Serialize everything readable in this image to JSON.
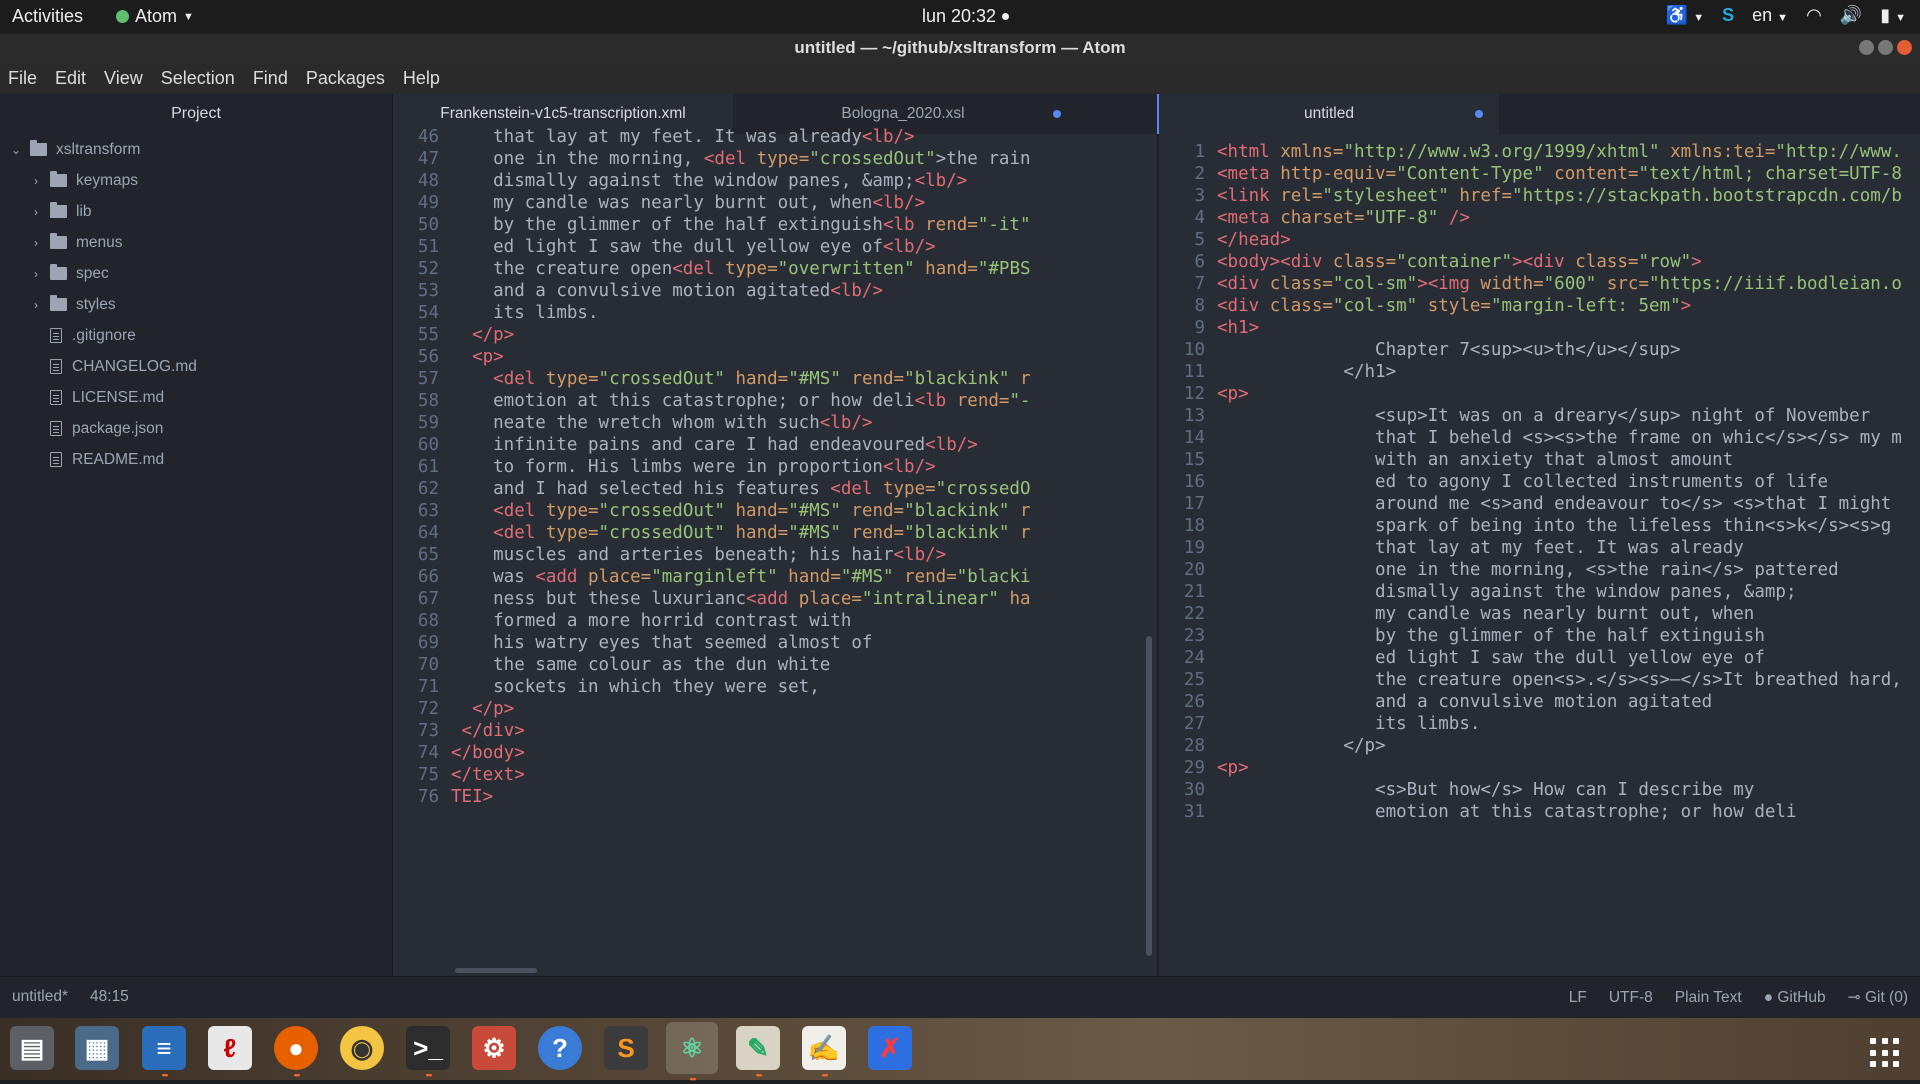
{
  "topbar": {
    "activities": "Activities",
    "app_name": "Atom",
    "clock": "lun 20:32",
    "lang": "en"
  },
  "window": {
    "title": "untitled — ~/github/xsltransform — Atom"
  },
  "menu": [
    "File",
    "Edit",
    "View",
    "Selection",
    "Find",
    "Packages",
    "Help"
  ],
  "tree": {
    "header": "Project",
    "root": "xsltransform",
    "folders": [
      "keymaps",
      "lib",
      "menus",
      "spec",
      "styles"
    ],
    "files": [
      ".gitignore",
      "CHANGELOG.md",
      "LICENSE.md",
      "package.json",
      "README.md"
    ]
  },
  "left_tabs": [
    {
      "label": "Frankenstein-v1c5-transcription.xml",
      "modified": false,
      "active": true
    },
    {
      "label": "Bologna_2020.xsl",
      "modified": true,
      "active": false
    }
  ],
  "right_tabs": [
    {
      "label": "untitled",
      "modified": true,
      "active": true
    }
  ],
  "left_lines": [
    {
      "n": "46",
      "t": [
        [
          "    that lay at my feet. It was already",
          ""
        ],
        [
          "<lb/>",
          "tg"
        ]
      ]
    },
    {
      "n": "47",
      "t": [
        [
          "    one in the morning, ",
          ""
        ],
        [
          "<del ",
          "tg"
        ],
        [
          "type=",
          "at"
        ],
        [
          "\"crossedOut\"",
          "st"
        ],
        [
          ">the rain",
          ""
        ]
      ]
    },
    {
      "n": "48",
      "t": [
        [
          "    dismally against the window panes, &amp;",
          ""
        ],
        [
          "<lb/>",
          "tg"
        ]
      ]
    },
    {
      "n": "49",
      "t": [
        [
          "    my candle was nearly burnt out, when",
          ""
        ],
        [
          "<lb/>",
          "tg"
        ]
      ]
    },
    {
      "n": "50",
      "t": [
        [
          "    by the glimmer of the half extinguish",
          ""
        ],
        [
          "<lb ",
          "tg"
        ],
        [
          "rend=",
          "at"
        ],
        [
          "\"-it\"",
          "st"
        ]
      ]
    },
    {
      "n": "51",
      "t": [
        [
          "    ed light I saw the dull yellow eye of",
          ""
        ],
        [
          "<lb/>",
          "tg"
        ]
      ]
    },
    {
      "n": "52",
      "t": [
        [
          "    the creature open",
          ""
        ],
        [
          "<del ",
          "tg"
        ],
        [
          "type=",
          "at"
        ],
        [
          "\"overwritten\" ",
          "st"
        ],
        [
          "hand=",
          "at"
        ],
        [
          "\"#PBS",
          "st"
        ]
      ]
    },
    {
      "n": "53",
      "t": [
        [
          "    and a convulsive motion agitated",
          ""
        ],
        [
          "<lb/>",
          "tg"
        ]
      ]
    },
    {
      "n": "54",
      "t": [
        [
          "    its limbs.",
          ""
        ]
      ]
    },
    {
      "n": "55",
      "t": [
        [
          "  ",
          ""
        ],
        [
          "</p>",
          "tg"
        ]
      ]
    },
    {
      "n": "56",
      "t": [
        [
          "  ",
          ""
        ],
        [
          "<p>",
          "tg"
        ]
      ]
    },
    {
      "n": "57",
      "t": [
        [
          "    ",
          ""
        ],
        [
          "<del ",
          "tg"
        ],
        [
          "type=",
          "at"
        ],
        [
          "\"crossedOut\" ",
          "st"
        ],
        [
          "hand=",
          "at"
        ],
        [
          "\"#MS\" ",
          "st"
        ],
        [
          "rend=",
          "at"
        ],
        [
          "\"blackink\" ",
          "st"
        ],
        [
          "r",
          "at"
        ]
      ]
    },
    {
      "n": "58",
      "t": [
        [
          "    emotion at this catastrophe; or how deli",
          ""
        ],
        [
          "<lb ",
          "tg"
        ],
        [
          "rend=",
          "at"
        ],
        [
          "\"-",
          "st"
        ]
      ]
    },
    {
      "n": "59",
      "t": [
        [
          "    neate the wretch whom with such",
          ""
        ],
        [
          "<lb/>",
          "tg"
        ]
      ]
    },
    {
      "n": "60",
      "t": [
        [
          "    infinite pains and care I had endeavoured",
          ""
        ],
        [
          "<lb/>",
          "tg"
        ]
      ]
    },
    {
      "n": "61",
      "t": [
        [
          "    to form. His limbs were in proportion",
          ""
        ],
        [
          "<lb/>",
          "tg"
        ]
      ]
    },
    {
      "n": "62",
      "t": [
        [
          "    and I had selected his features ",
          ""
        ],
        [
          "<del ",
          "tg"
        ],
        [
          "type=",
          "at"
        ],
        [
          "\"crossedO",
          "st"
        ]
      ]
    },
    {
      "n": "63",
      "t": [
        [
          "    ",
          ""
        ],
        [
          "<del ",
          "tg"
        ],
        [
          "type=",
          "at"
        ],
        [
          "\"crossedOut\" ",
          "st"
        ],
        [
          "hand=",
          "at"
        ],
        [
          "\"#MS\" ",
          "st"
        ],
        [
          "rend=",
          "at"
        ],
        [
          "\"blackink\" ",
          "st"
        ],
        [
          "r",
          "at"
        ]
      ]
    },
    {
      "n": "64",
      "t": [
        [
          "    ",
          ""
        ],
        [
          "<del ",
          "tg"
        ],
        [
          "type=",
          "at"
        ],
        [
          "\"crossedOut\" ",
          "st"
        ],
        [
          "hand=",
          "at"
        ],
        [
          "\"#MS\" ",
          "st"
        ],
        [
          "rend=",
          "at"
        ],
        [
          "\"blackink\" ",
          "st"
        ],
        [
          "r",
          "at"
        ]
      ]
    },
    {
      "n": "65",
      "t": [
        [
          "    muscles and arteries beneath; his hair",
          ""
        ],
        [
          "<lb/>",
          "tg"
        ]
      ]
    },
    {
      "n": "66",
      "t": [
        [
          "    was ",
          ""
        ],
        [
          "<add ",
          "tg"
        ],
        [
          "place=",
          "at"
        ],
        [
          "\"marginleft\" ",
          "st"
        ],
        [
          "hand=",
          "at"
        ],
        [
          "\"#MS\" ",
          "st"
        ],
        [
          "rend=",
          "at"
        ],
        [
          "\"blacki",
          "st"
        ]
      ]
    },
    {
      "n": "67",
      "t": [
        [
          "    ness but these luxurianc",
          ""
        ],
        [
          "<add ",
          "tg"
        ],
        [
          "place=",
          "at"
        ],
        [
          "\"intralinear\" ",
          "st"
        ],
        [
          "ha",
          "at"
        ]
      ]
    },
    {
      "n": "68",
      "t": [
        [
          "    formed a more horrid contrast with",
          ""
        ]
      ]
    },
    {
      "n": "69",
      "t": [
        [
          "    his watry eyes that seemed almost of",
          ""
        ]
      ]
    },
    {
      "n": "70",
      "t": [
        [
          "    the same colour as the dun white",
          ""
        ]
      ]
    },
    {
      "n": "71",
      "t": [
        [
          "    sockets in which they were set,",
          ""
        ]
      ]
    },
    {
      "n": "72",
      "t": [
        [
          "  ",
          ""
        ],
        [
          "</p>",
          "tg"
        ]
      ]
    },
    {
      "n": "73",
      "t": [
        [
          " ",
          ""
        ],
        [
          "</div>",
          "tg"
        ]
      ]
    },
    {
      "n": "74",
      "t": [
        [
          "",
          ""
        ],
        [
          "</body>",
          "tg"
        ]
      ]
    },
    {
      "n": "75",
      "t": [
        [
          "",
          ""
        ],
        [
          "</text>",
          "tg"
        ]
      ]
    },
    {
      "n": "76",
      "t": [
        [
          "",
          ""
        ],
        [
          "TEI>",
          "tg"
        ]
      ]
    }
  ],
  "right_lines": [
    {
      "n": "1",
      "t": [
        [
          "<html ",
          "tg"
        ],
        [
          "xmlns=",
          "at"
        ],
        [
          "\"http://www.w3.org/1999/xhtml\" ",
          "st"
        ],
        [
          "xmlns:tei=",
          "at"
        ],
        [
          "\"http://www.",
          "st"
        ]
      ]
    },
    {
      "n": "2",
      "t": [
        [
          "<meta ",
          "tg"
        ],
        [
          "http-equiv=",
          "at"
        ],
        [
          "\"Content-Type\" ",
          "st"
        ],
        [
          "content=",
          "at"
        ],
        [
          "\"text/html; charset=UTF-8",
          "st"
        ]
      ]
    },
    {
      "n": "3",
      "t": [
        [
          "<link ",
          "tg"
        ],
        [
          "rel=",
          "at"
        ],
        [
          "\"stylesheet\" ",
          "st"
        ],
        [
          "href=",
          "at"
        ],
        [
          "\"https://stackpath.bootstrapcdn.com/b",
          "st"
        ]
      ]
    },
    {
      "n": "4",
      "t": [
        [
          "<meta ",
          "tg"
        ],
        [
          "charset=",
          "at"
        ],
        [
          "\"UTF-8\" ",
          "st"
        ],
        [
          "/>",
          "tg"
        ]
      ]
    },
    {
      "n": "5",
      "t": [
        [
          "</head>",
          "tg"
        ]
      ]
    },
    {
      "n": "6",
      "t": [
        [
          "<body><div ",
          "tg"
        ],
        [
          "class=",
          "at"
        ],
        [
          "\"container\"",
          "st"
        ],
        [
          "><div ",
          "tg"
        ],
        [
          "class=",
          "at"
        ],
        [
          "\"row\"",
          "st"
        ],
        [
          ">",
          "tg"
        ]
      ]
    },
    {
      "n": "7",
      "t": [
        [
          "<div ",
          "tg"
        ],
        [
          "class=",
          "at"
        ],
        [
          "\"col-sm\"",
          "st"
        ],
        [
          "><img ",
          "tg"
        ],
        [
          "width=",
          "at"
        ],
        [
          "\"600\" ",
          "st"
        ],
        [
          "src=",
          "at"
        ],
        [
          "\"https://iiif.bodleian.o",
          "st"
        ]
      ]
    },
    {
      "n": "8",
      "t": [
        [
          "<div ",
          "tg"
        ],
        [
          "class=",
          "at"
        ],
        [
          "\"col-sm\" ",
          "st"
        ],
        [
          "style=",
          "at"
        ],
        [
          "\"margin-left: 5em\"",
          "st"
        ],
        [
          ">",
          "tg"
        ]
      ]
    },
    {
      "n": "9",
      "t": [
        [
          "<h1>",
          "tg"
        ]
      ]
    },
    {
      "n": "10",
      "t": [
        [
          "               Chapter 7<sup><u>th</u></sup>",
          ""
        ]
      ]
    },
    {
      "n": "11",
      "t": [
        [
          "            </h1>",
          ""
        ]
      ]
    },
    {
      "n": "12",
      "t": [
        [
          "<p>",
          "tg"
        ]
      ]
    },
    {
      "n": "13",
      "t": [
        [
          "               <sup>It was on a dreary</sup> night of November",
          ""
        ]
      ]
    },
    {
      "n": "14",
      "t": [
        [
          "               that I beheld <s><s>the frame on whic</s></s> my m",
          ""
        ]
      ]
    },
    {
      "n": "15",
      "t": [
        [
          "               with an anxiety that almost amount",
          ""
        ]
      ]
    },
    {
      "n": "16",
      "t": [
        [
          "               ed to agony I collected instruments of life",
          ""
        ]
      ]
    },
    {
      "n": "17",
      "t": [
        [
          "               around me <s>and endeavour to</s> <s>that I might",
          ""
        ]
      ]
    },
    {
      "n": "18",
      "t": [
        [
          "               spark of being into the lifeless thin<s>k</s><s>g",
          ""
        ]
      ]
    },
    {
      "n": "19",
      "t": [
        [
          "               that lay at my feet. It was already",
          ""
        ]
      ]
    },
    {
      "n": "20",
      "t": [
        [
          "               one in the morning, <s>the rain</s> pattered",
          ""
        ]
      ]
    },
    {
      "n": "21",
      "t": [
        [
          "               dismally against the window panes, &amp;",
          ""
        ]
      ]
    },
    {
      "n": "22",
      "t": [
        [
          "               my candle was nearly burnt out, when",
          ""
        ]
      ]
    },
    {
      "n": "23",
      "t": [
        [
          "               by the glimmer of the half extinguish",
          ""
        ]
      ]
    },
    {
      "n": "24",
      "t": [
        [
          "               ed light I saw the dull yellow eye of",
          ""
        ]
      ]
    },
    {
      "n": "25",
      "t": [
        [
          "               the creature open<s>.</s><s>—</s>It breathed hard,",
          ""
        ]
      ]
    },
    {
      "n": "26",
      "t": [
        [
          "               and a convulsive motion agitated",
          ""
        ]
      ]
    },
    {
      "n": "27",
      "t": [
        [
          "               its limbs.",
          ""
        ]
      ]
    },
    {
      "n": "28",
      "t": [
        [
          "            </p>",
          ""
        ]
      ]
    },
    {
      "n": "29",
      "t": [
        [
          "<p>",
          "tg"
        ]
      ]
    },
    {
      "n": "30",
      "t": [
        [
          "               <s>But how</s> How can I describe my",
          ""
        ]
      ]
    },
    {
      "n": "31",
      "t": [
        [
          "               emotion at this catastrophe; or how deli",
          ""
        ]
      ]
    }
  ],
  "status": {
    "file": "untitled*",
    "cursor": "48:15",
    "line_ending": "LF",
    "encoding": "UTF-8",
    "grammar": "Plain Text",
    "github": "GitHub",
    "git": "Git (0)"
  },
  "dock": [
    "files-icon",
    "photos-icon",
    "writer-icon",
    "pdf-icon",
    "firefox-icon",
    "rhythmbox-icon",
    "terminal-icon",
    "settings-icon",
    "help-icon",
    "sublime-icon",
    "atom-icon",
    "image-viewer-icon",
    "text-editor-icon",
    "xmind-icon"
  ]
}
